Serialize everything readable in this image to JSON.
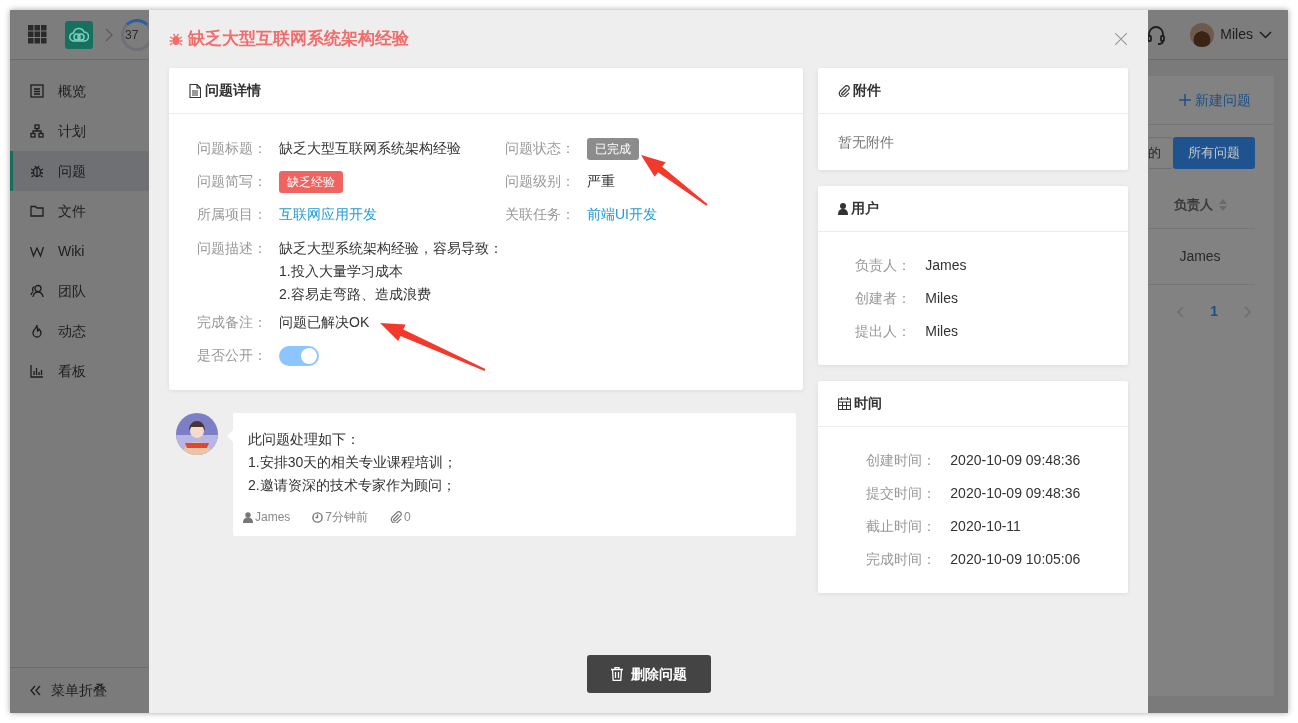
{
  "app": {
    "header": {
      "progress": "37",
      "user": "Miles"
    },
    "sidebar": {
      "items": [
        {
          "label": "概览",
          "selected": false
        },
        {
          "label": "计划",
          "selected": false
        },
        {
          "label": "问题",
          "selected": true
        },
        {
          "label": "文件",
          "selected": false
        },
        {
          "label": "Wiki",
          "selected": false
        },
        {
          "label": "团队",
          "selected": false
        },
        {
          "label": "动态",
          "selected": false
        },
        {
          "label": "看板",
          "selected": false
        }
      ],
      "collapse": "菜单折叠"
    },
    "content": {
      "new_button": "新建问题",
      "tabs": [
        {
          "label": "的",
          "selected": false
        },
        {
          "label": "所有问题",
          "selected": true
        }
      ],
      "column": "负责人",
      "cell": "James",
      "pages": [
        {
          "label": "1",
          "selected": true
        }
      ]
    }
  },
  "modal": {
    "title": "缺乏大型互联网系统架构经验",
    "details": {
      "title": "问题详情",
      "rows": [
        [
          {
            "kind": "text",
            "label": "问题标题：",
            "value": "缺乏大型互联网系统架构经验"
          },
          {
            "kind": "badge",
            "label": "问题状态：",
            "value": "已完成",
            "color": "#8c8c8c"
          }
        ],
        [
          {
            "kind": "badge",
            "label": "问题简写：",
            "value": "缺乏经验",
            "color": "#ef6461"
          },
          {
            "kind": "text",
            "label": "问题级别：",
            "value": "严重"
          }
        ],
        [
          {
            "kind": "link",
            "label": "所属项目：",
            "value": "互联网应用开发"
          },
          {
            "kind": "link",
            "label": "关联任务：",
            "value": "前端UI开发"
          }
        ],
        [
          {
            "kind": "lines",
            "label": "问题描述：",
            "lines": [
              "缺乏大型系统架构经验，容易导致：",
              "1.投入大量学习成本",
              "2.容易走弯路、造成浪费"
            ]
          }
        ],
        [
          {
            "kind": "text",
            "label": "完成备注：",
            "value": "问题已解决OK"
          }
        ],
        [
          {
            "kind": "switch",
            "label": "是否公开：",
            "on": true
          }
        ]
      ]
    },
    "comment": {
      "lines": [
        "此问题处理如下：",
        "1.安排30天的相关专业课程培训；",
        "2.邀请资深的技术专家作为顾问；"
      ],
      "author": "James",
      "time": "7分钟前",
      "attachments": "0"
    },
    "attachments": {
      "title": "附件",
      "empty": "暂无附件"
    },
    "users": {
      "title": "用户",
      "fields": [
        {
          "label": "负责人：",
          "value": "James"
        },
        {
          "label": "创建者：",
          "value": "Miles"
        },
        {
          "label": "提出人：",
          "value": "Miles"
        }
      ]
    },
    "times": {
      "title": "时间",
      "fields": [
        {
          "label": "创建时间：",
          "value": "2020-10-09 09:48:36"
        },
        {
          "label": "提交时间：",
          "value": "2020-10-09 09:48:36"
        },
        {
          "label": "截止时间：",
          "value": "2020-10-11"
        },
        {
          "label": "完成时间：",
          "value": "2020-10-09 10:05:06"
        }
      ]
    },
    "delete_button": "删除问题"
  }
}
